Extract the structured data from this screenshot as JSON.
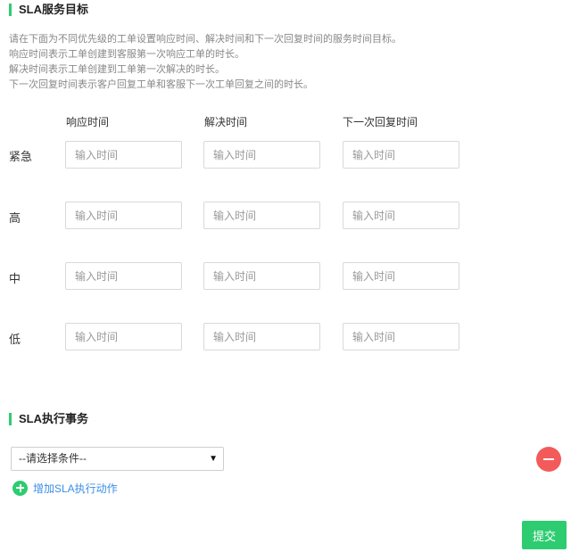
{
  "sla_goal": {
    "title": "SLA服务目标",
    "description": [
      "请在下面为不同优先级的工单设置响应时间、解决时间和下一次回复时间的服务时间目标。",
      "响应时间表示工单创建到客服第一次响应工单的时长。",
      "解决时间表示工单创建到工单第一次解决的时长。",
      "下一次回复时间表示客户回复工单和客服下一次工单回复之间的时长。"
    ],
    "columns": [
      "响应时间",
      "解决时间",
      "下一次回复时间"
    ],
    "rows": [
      {
        "label": "紧急"
      },
      {
        "label": "高"
      },
      {
        "label": "中"
      },
      {
        "label": "低"
      }
    ],
    "input_placeholder": "输入时间"
  },
  "sla_actions": {
    "title": "SLA执行事务",
    "condition_select": {
      "selected": "--请选择条件--"
    },
    "add_action_label": "增加SLA执行动作"
  },
  "submit_label": "提交",
  "colors": {
    "accent_green": "#2ecc71",
    "danger_red": "#f35b5b",
    "link_blue": "#3a8ee6"
  },
  "icons": {
    "remove": "minus-circle-icon",
    "add": "plus-circle-icon",
    "select": "caret-down-icon"
  }
}
